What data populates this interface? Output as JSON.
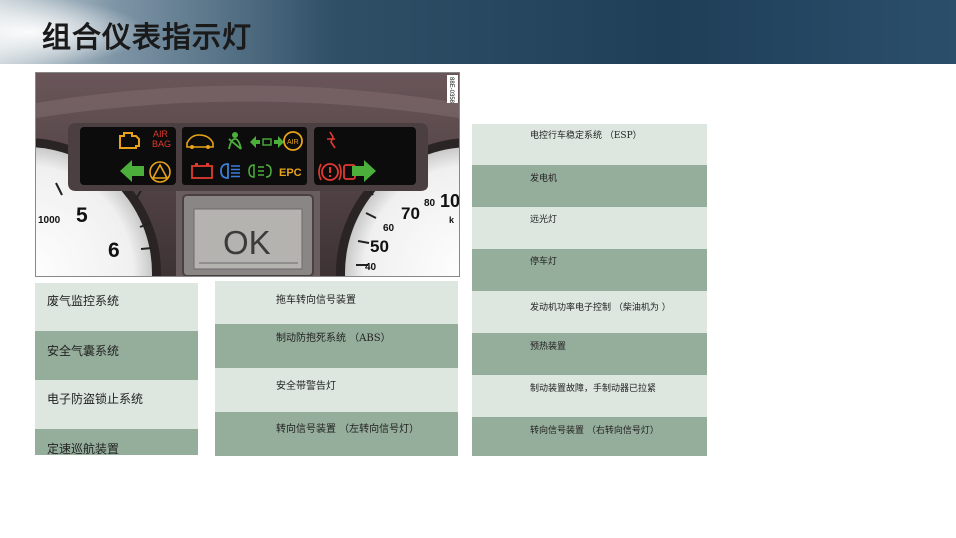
{
  "title": "组合仪表指示灯",
  "figure_code": "88E-0358",
  "dashboard": {
    "air_bag_line1": "AIR",
    "air_bag_line2": "BAG",
    "epc": "EPC",
    "ok": "OK",
    "air_icon": "AIR",
    "left_ticks": [
      "1000",
      "5",
      "6"
    ],
    "right_ticks": [
      "80",
      "10",
      "70",
      "60",
      "50",
      "40",
      "k"
    ],
    "icons": [
      "engine-check-icon",
      "airbag-text-icon",
      "car-alarm-icon",
      "seatbelt-icon",
      "turn-signal-icon",
      "abs-icon",
      "trailer-warning-icon",
      "left-arrow-icon",
      "warning-triangle-icon",
      "battery-icon",
      "high-beam-icon",
      "fog-light-icon",
      "epc-icon",
      "brake-warning-icon",
      "right-arrow-icon"
    ]
  },
  "col1": [
    "废气监控系统",
    "安全气囊系统",
    "电子防盗锁止系统",
    "定速巡航装置"
  ],
  "col2": [
    "拖车转向信号装置",
    "制动防抱死系统 （ABS）",
    "安全带警告灯",
    "转向信号装置 （左转向信号灯）"
  ],
  "col3": [
    "电控行车稳定系统 （ESP）",
    "发电机",
    "远光灯",
    "停车灯",
    "发动机功率电子控制 （柴油机为   ）",
    "预热装置",
    "制动装置故障，手制动器已拉紧",
    "转向信号装置 （右转向信号灯）"
  ],
  "colors": {
    "green_light": "#4caf3c",
    "amber_light": "#e8a21a",
    "red_light": "#e03a30",
    "blue_light": "#3a7fd8",
    "cell_light": "#dde7df",
    "cell_dark": "#95ad9b"
  }
}
